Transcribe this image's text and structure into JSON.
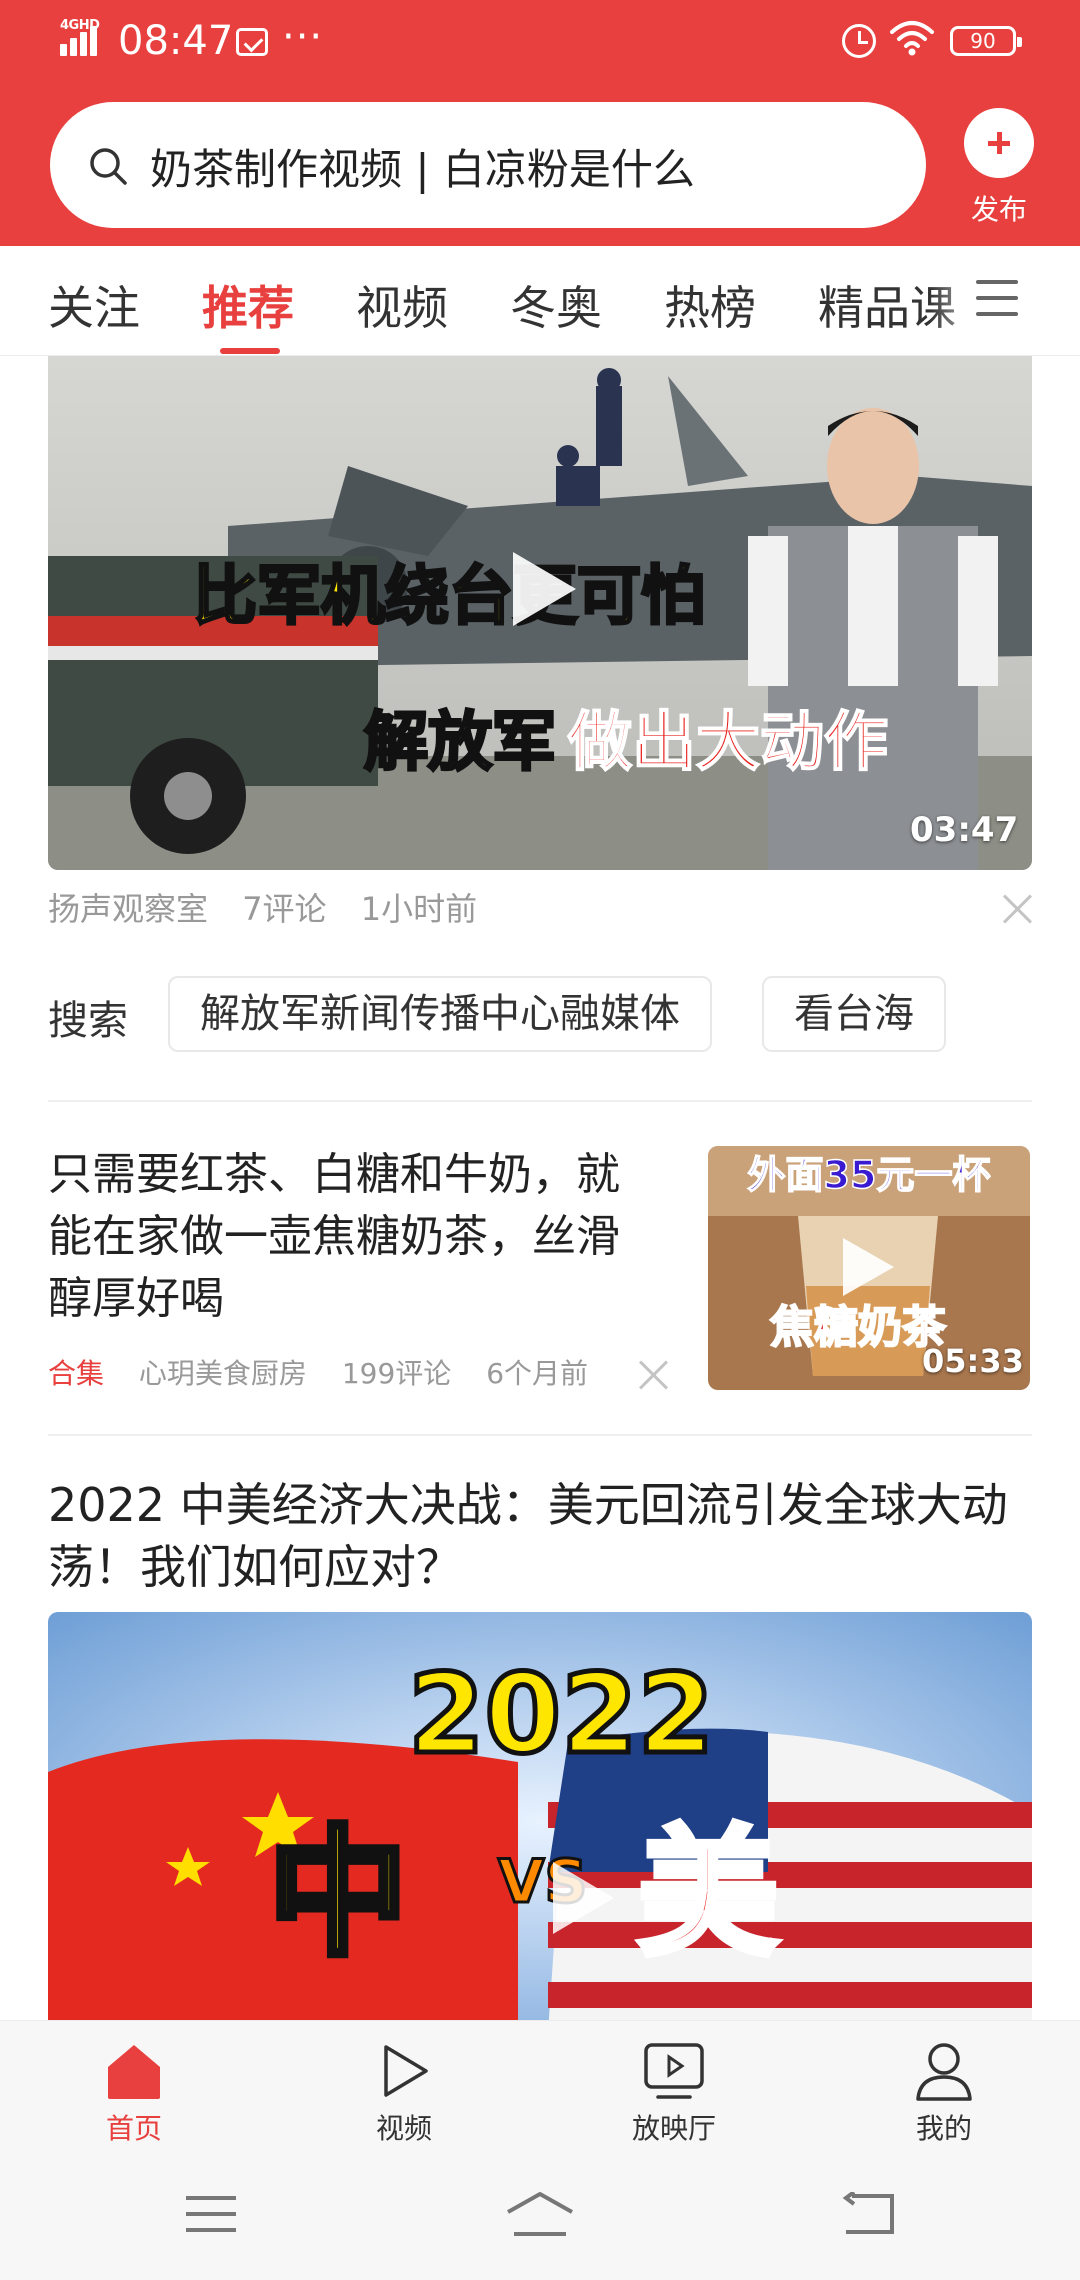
{
  "status_bar": {
    "network": "4GHD",
    "time": "08:47",
    "more": "···",
    "battery": "90"
  },
  "header": {
    "search_text": "奶茶制作视频 | 白凉粉是什么",
    "publish_label": "发布"
  },
  "tabs": [
    {
      "label": "关注",
      "active": false
    },
    {
      "label": "推荐",
      "active": true
    },
    {
      "label": "视频",
      "active": false
    },
    {
      "label": "冬奥",
      "active": false
    },
    {
      "label": "热榜",
      "active": false
    },
    {
      "label": "精品课",
      "active": false
    }
  ],
  "feed": {
    "item1": {
      "overlay_line1": "比军机绕台更可怕",
      "overlay_line2a": "解放军",
      "overlay_line2b": "做出大动作",
      "duration": "03:47",
      "source": "扬声观察室",
      "comments": "7评论",
      "time": "1小时前"
    },
    "search_row": {
      "label": "搜索",
      "chips": [
        "解放军新闻传播中心融媒体",
        "看台海"
      ]
    },
    "item2": {
      "title": "只需要红茶、白糖和牛奶，就能在家做一壶焦糖奶茶，丝滑醇厚好喝",
      "tag": "合集",
      "source": "心玥美食厨房",
      "comments": "199评论",
      "time": "6个月前",
      "thumb_top_text": "外面35元一杯",
      "thumb_bottom_text": "焦糖奶茶",
      "duration": "05:33"
    },
    "item3": {
      "title": "2022 中美经济大决战：美元回流引发全球大动荡！我们如何应对？",
      "thumb_year": "2022",
      "thumb_left": "中",
      "thumb_vs": "VS",
      "thumb_right": "美"
    }
  },
  "bottom_nav": [
    {
      "label": "首页",
      "icon": "home-icon",
      "active": true
    },
    {
      "label": "视频",
      "icon": "video-play-icon",
      "active": false
    },
    {
      "label": "放映厅",
      "icon": "screen-icon",
      "active": false
    },
    {
      "label": "我的",
      "icon": "person-icon",
      "active": false
    }
  ],
  "colors": {
    "brand_red": "#e8403e",
    "meta_gray": "#999999"
  }
}
